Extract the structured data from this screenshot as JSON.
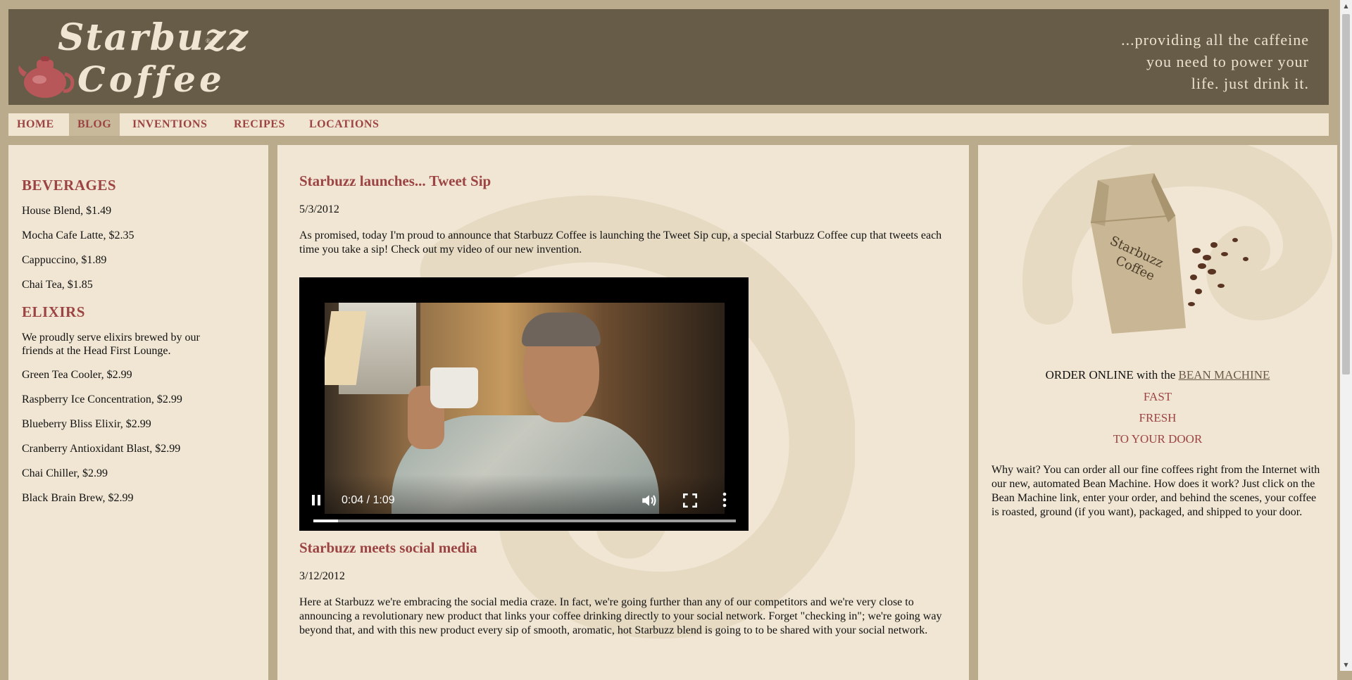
{
  "header": {
    "logo_line1": "Starbuzz",
    "logo_line2": "Coffee",
    "logo_tm": "®",
    "tagline": [
      "...providing all the caffeine",
      "you need to power your",
      "life. just drink it."
    ],
    "colors": {
      "header_bg": "#675c47",
      "accent": "#9c4443"
    }
  },
  "nav": {
    "items": [
      {
        "label": "HOME",
        "active": false
      },
      {
        "label": "BLOG",
        "active": true
      },
      {
        "label": "INVENTIONS",
        "active": false
      },
      {
        "label": "RECIPES",
        "active": false
      },
      {
        "label": "LOCATIONS",
        "active": false
      }
    ]
  },
  "sidebar": {
    "beverages_heading": "BEVERAGES",
    "beverages": [
      "House Blend, $1.49",
      "Mocha Cafe Latte, $2.35",
      "Cappuccino, $1.89",
      "Chai Tea, $1.85"
    ],
    "elixirs_heading": "ELIXIRS",
    "elixirs_intro": "We proudly serve elixirs brewed by our friends at the Head First Lounge.",
    "elixirs": [
      "Green Tea Cooler, $2.99",
      "Raspberry Ice Concentration, $2.99",
      "Blueberry Bliss Elixir, $2.99",
      "Cranberry Antioxidant Blast, $2.99",
      "Chai Chiller, $2.99",
      "Black Brain Brew, $2.99"
    ]
  },
  "main": {
    "posts": [
      {
        "title": "Starbuzz launches... Tweet Sip",
        "date": "5/3/2012",
        "body": "As promised, today I'm proud to announce that Starbuzz Coffee is launching the Tweet Sip cup, a special Starbuzz Coffee cup that tweets each time you take a sip! Check out my video of our new invention."
      },
      {
        "title": "Starbuzz meets social media",
        "date": "3/12/2012",
        "body": "Here at Starbuzz we're embracing the social media craze. In fact, we're going further than any of our competitors and we're very close to announcing a revolutionary new product that links your coffee drinking directly to your social network. Forget \"checking in\"; we're going way beyond that, and with this new product every sip of smooth, aromatic, hot Starbuzz blend is going to to be shared with your social network."
      }
    ],
    "video": {
      "time": "0:04 / 1:09",
      "progress": 0.058,
      "icons": [
        "pause-icon",
        "volume-icon",
        "fullscreen-icon",
        "more-options-icon"
      ]
    }
  },
  "right": {
    "order_prefix": "ORDER ONLINE with the ",
    "order_link": "BEAN MACHINE",
    "taglines": [
      "FAST",
      "FRESH",
      "TO YOUR DOOR"
    ],
    "body": "Why wait? You can order all our fine coffees right from the Internet with our new, automated Bean Machine. How does it work? Just click on the Bean Machine link, enter your order, and behind the scenes, your coffee is roasted, ground (if you want), packaged, and shipped to your door."
  }
}
